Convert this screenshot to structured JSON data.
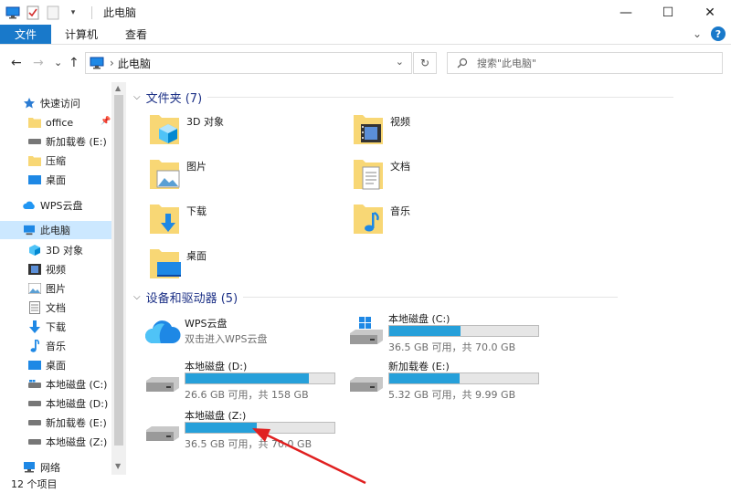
{
  "window": {
    "title": "此电脑",
    "min": "—",
    "max": "☐",
    "close": "✕"
  },
  "ribbon": {
    "tabs": [
      "文件",
      "计算机",
      "查看"
    ],
    "collapse": "⌄",
    "help": "?"
  },
  "address": {
    "back": "←",
    "forward": "→",
    "recent": "⌄",
    "up": "↑",
    "path": "此电脑",
    "sep": "›",
    "dropdown": "⌄",
    "refresh": "↻",
    "search_placeholder": "搜索\"此电脑\""
  },
  "sidebar": {
    "quick_access": "快速访问",
    "quick_items": [
      "office",
      "新加载卷 (E:)",
      "压缩",
      "桌面"
    ],
    "wps": "WPS云盘",
    "this_pc": "此电脑",
    "pc_items": [
      "3D 对象",
      "视频",
      "图片",
      "文档",
      "下载",
      "音乐",
      "桌面",
      "本地磁盘 (C:)",
      "本地磁盘 (D:)",
      "新加载卷 (E:)",
      "本地磁盘 (Z:)"
    ],
    "network": "网络"
  },
  "folders_group": {
    "label": "文件夹 (7)",
    "items": [
      "3D 对象",
      "视频",
      "图片",
      "文档",
      "下载",
      "音乐",
      "桌面"
    ]
  },
  "devices_group": {
    "label": "设备和驱动器 (5)",
    "wps": {
      "name": "WPS云盘",
      "sub": "双击进入WPS云盘"
    },
    "drives": [
      {
        "name": "本地磁盘 (C:)",
        "info": "36.5 GB 可用，共 70.0 GB",
        "used_fraction": 0.48
      },
      {
        "name": "本地磁盘 (D:)",
        "info": "26.6 GB 可用，共 158 GB",
        "used_fraction": 0.83
      },
      {
        "name": "新加载卷 (E:)",
        "info": "5.32 GB 可用，共 9.99 GB",
        "used_fraction": 0.47
      },
      {
        "name": "本地磁盘 (Z:)",
        "info": "36.5 GB 可用，共 70.0 GB",
        "used_fraction": 0.48
      }
    ]
  },
  "status": {
    "item_count": "12 个项目"
  },
  "colors": {
    "accent": "#1979ca",
    "bar_fill": "#26a0da",
    "selection": "#cce8ff",
    "group_header": "#1e3287",
    "annotation_arrow": "#e02020"
  }
}
